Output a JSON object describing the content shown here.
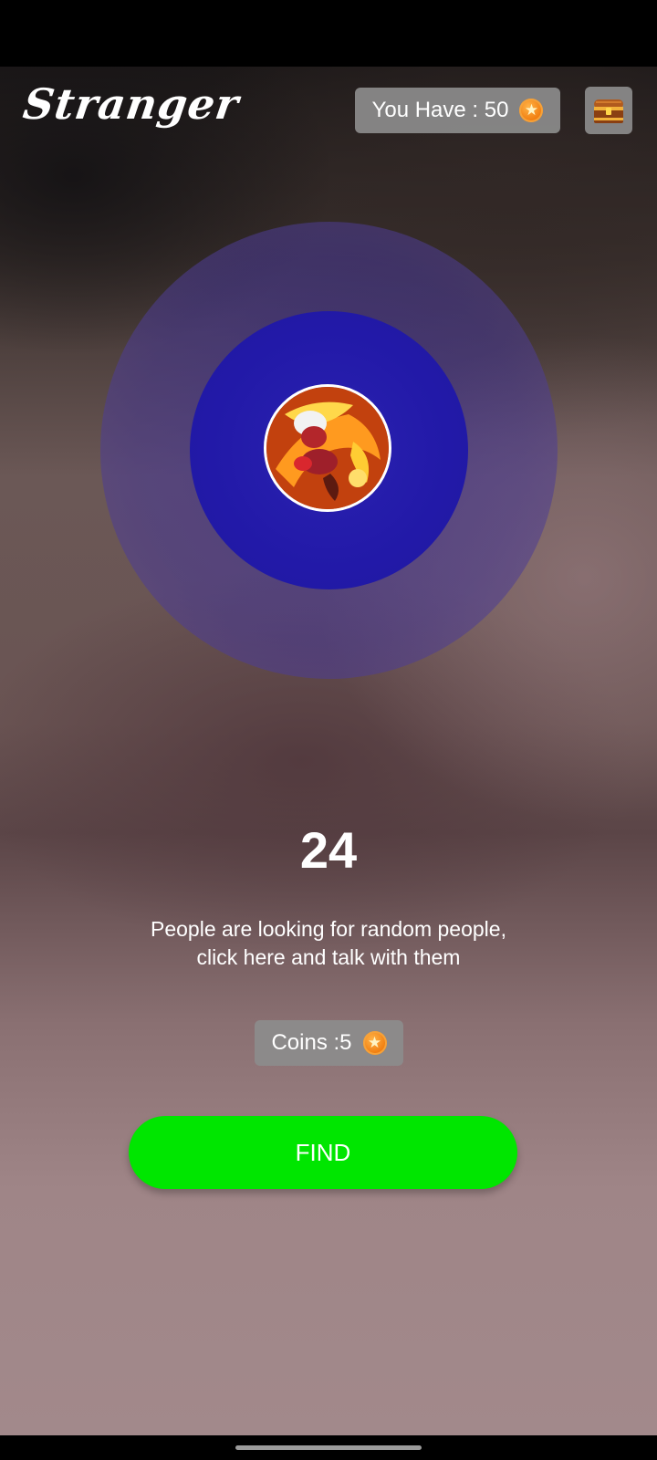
{
  "header": {
    "app_title": "Stranger",
    "balance_label": "You Have : 50",
    "balance_icon": "coin-icon",
    "chest_icon": "treasure-chest-icon"
  },
  "radar": {
    "avatar_icon": "avatar-icon"
  },
  "main": {
    "count": "24",
    "subtext_line1": "People are looking for random people,",
    "subtext_line2": "click here and talk with them",
    "cost_label": "Coins :5",
    "find_label": "FIND"
  },
  "colors": {
    "find_button": "#00e600",
    "radar_inner": "#2219a8",
    "pill_bg": "#8c8c8c"
  }
}
